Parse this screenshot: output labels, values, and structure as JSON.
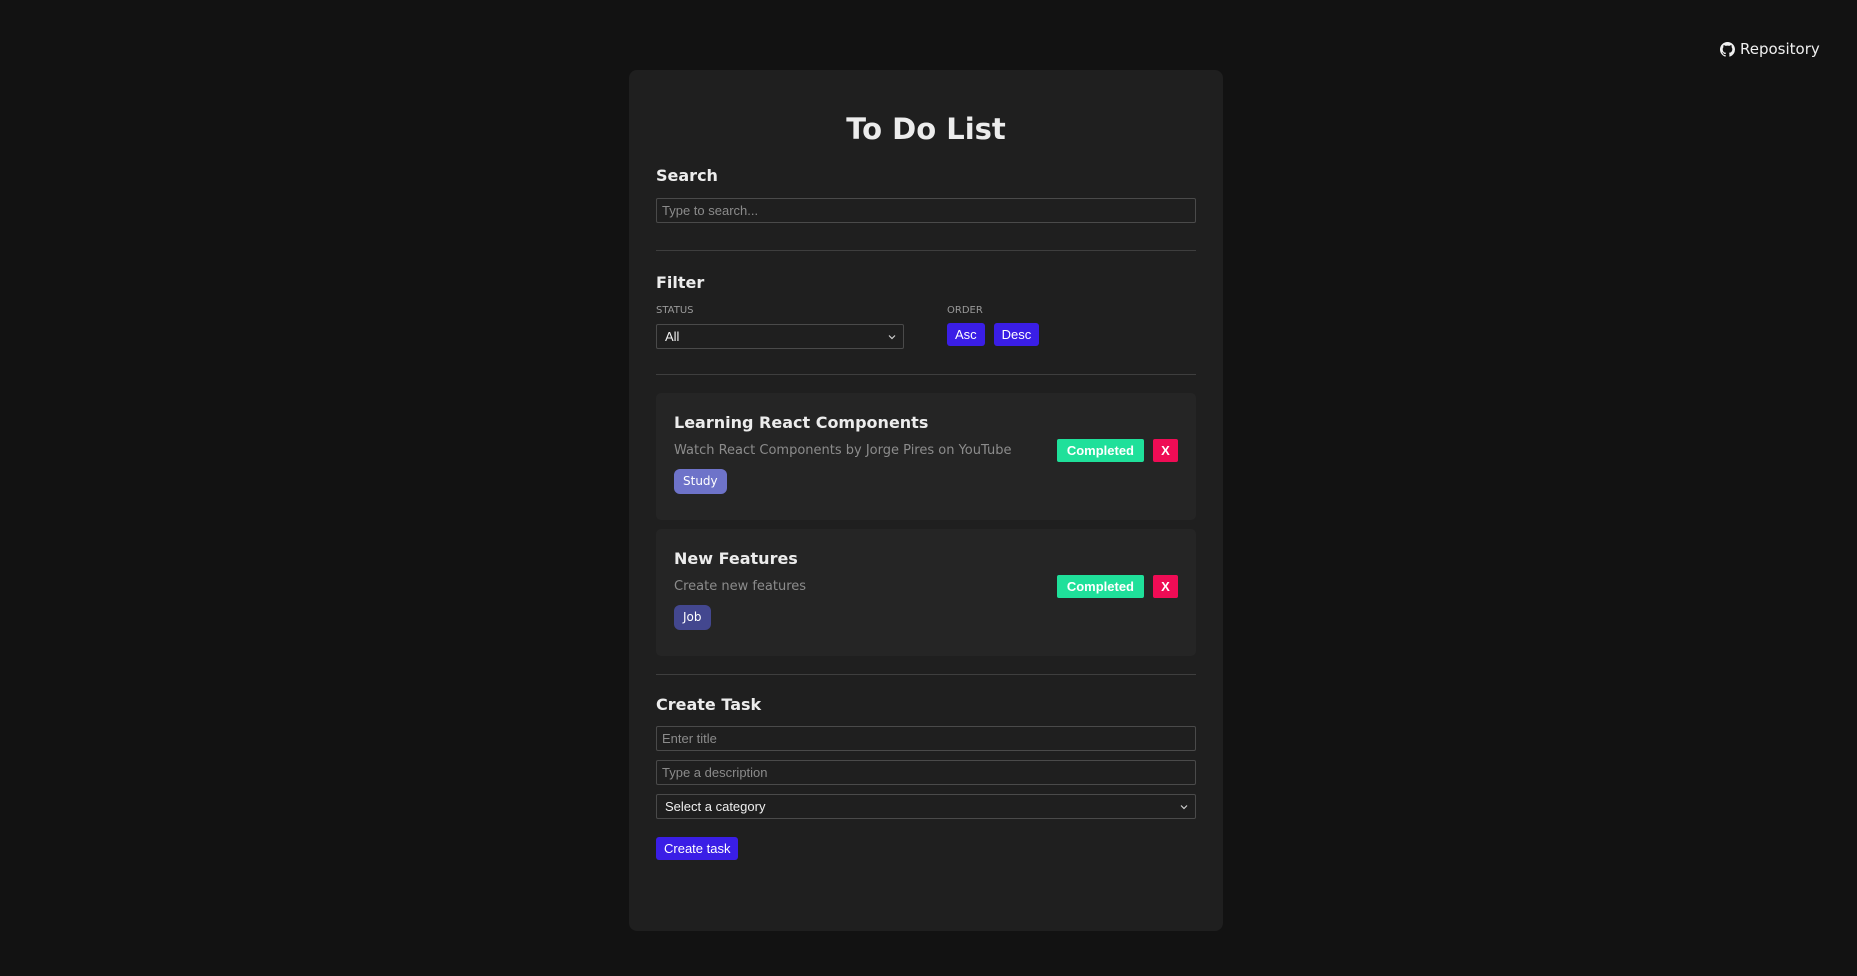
{
  "header": {
    "repo_label": "Repository"
  },
  "app": {
    "title": "To Do List"
  },
  "search": {
    "title": "Search",
    "placeholder": "Type to search..."
  },
  "filter": {
    "title": "Filter",
    "status_label": "STATUS",
    "status_value": "All",
    "order_label": "ORDER",
    "asc_label": "Asc",
    "desc_label": "Desc"
  },
  "todos": [
    {
      "title": "Learning React Components",
      "description": "Watch React Components by Jorge Pires on YouTube",
      "category": "Study",
      "category_color": "#6e73c9",
      "complete_label": "Completed",
      "remove_label": "X"
    },
    {
      "title": "New Features",
      "description": "Create new features",
      "category": "Job",
      "category_color": "#43478f",
      "complete_label": "Completed",
      "remove_label": "X"
    }
  ],
  "create": {
    "title": "Create Task",
    "title_placeholder": "Enter title",
    "description_placeholder": "Type a description",
    "category_value": "Select a category",
    "button_label": "Create task"
  },
  "colors": {
    "accent": "#3a1ee6",
    "complete": "#1fe09a",
    "remove": "#ef0c55",
    "background": "#121212",
    "card": "#1f1f1f"
  }
}
